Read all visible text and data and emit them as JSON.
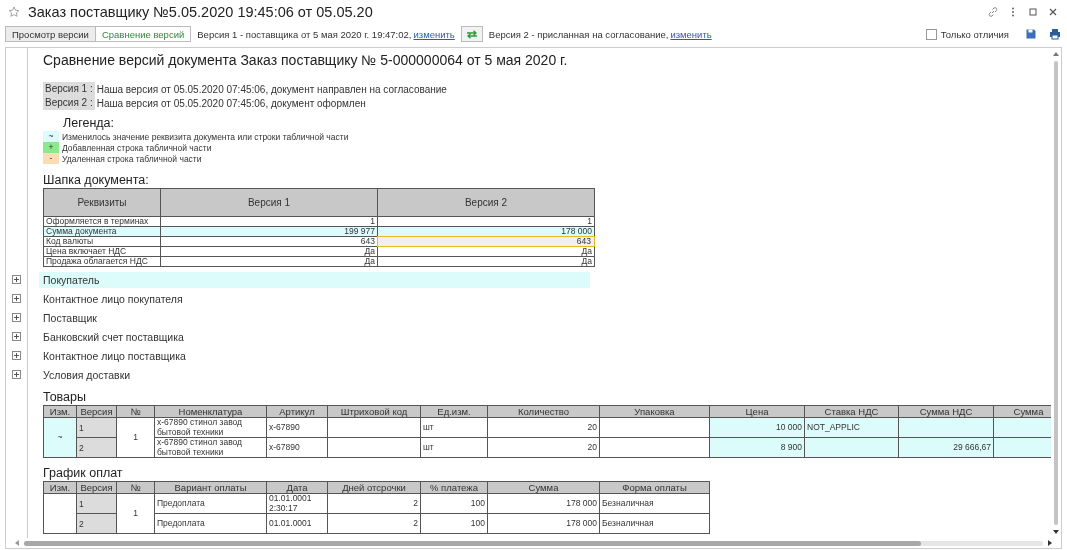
{
  "window": {
    "title": "Заказ поставщику №5.05.2020 19:45:06 от 05.05.20"
  },
  "toolbar": {
    "view_tabs": [
      {
        "label": "Просмотр версии",
        "selected": false
      },
      {
        "label": "Сравнение версий",
        "selected": true
      }
    ],
    "version1": {
      "text": "Версия 1 - поставщика от 5 мая 2020 г. 19:47:02,",
      "link": "изменить"
    },
    "version2": {
      "text": "Версия 2 - присланная на согласование,",
      "link": "изменить"
    },
    "only_differences": {
      "label": "Только отличия",
      "checked": false
    }
  },
  "document": {
    "title": "Сравнение версий документа Заказ поставщику № 5-000000064 от 5 мая 2020 г.",
    "versions": [
      {
        "label": "Версия 1 :",
        "text": "Наша версия от 05.05.2020 07:45:06, документ направлен на согласование"
      },
      {
        "label": "Версия 2 :",
        "text": "Наша версия от 05.05.2020 07:45:06, документ оформлен"
      }
    ],
    "legend": {
      "title": "Легенда:",
      "items": [
        {
          "mark": "~",
          "text": "Изменилось значение реквизита документа или строки табличной части",
          "color": "#dcfcfc"
        },
        {
          "mark": "+",
          "text": "Добавленная строка табличной части",
          "color": "#8ce88c"
        },
        {
          "mark": "-",
          "text": "Удаленная строка табличной части",
          "color": "#fcdcb4"
        }
      ]
    },
    "header_section": {
      "title": "Шапка документа:",
      "columns": [
        "Реквизиты",
        "Версия 1",
        "Версия 2"
      ],
      "rows": [
        {
          "cells": [
            "Оформляется в терминах",
            "1",
            "1"
          ],
          "changed": false,
          "selected": false
        },
        {
          "cells": [
            "Сумма документа",
            "199 977",
            "178 000"
          ],
          "changed": true,
          "selected": false
        },
        {
          "cells": [
            "Код валюты",
            "643",
            "643"
          ],
          "changed": false,
          "selected": true
        },
        {
          "cells": [
            "Цена включает НДС",
            "Да",
            "Да"
          ],
          "changed": false,
          "selected": false
        },
        {
          "cells": [
            "Продажа облагается НДС",
            "Да",
            "Да"
          ],
          "changed": false,
          "selected": false
        }
      ]
    },
    "groups": [
      {
        "label": "Покупатель",
        "changed": true,
        "expanded": false
      },
      {
        "label": "Контактное лицо покупателя",
        "changed": false,
        "expanded": false
      },
      {
        "label": "Поставщик",
        "changed": false,
        "expanded": false
      },
      {
        "label": "Банковский счет поставщика",
        "changed": false,
        "expanded": false
      },
      {
        "label": "Контактное лицо поставщика",
        "changed": false,
        "expanded": false
      },
      {
        "label": "Условия доставки",
        "changed": false,
        "expanded": false
      }
    ],
    "tables": [
      {
        "title": "Товары",
        "columns": [
          {
            "label": "Изм.",
            "kind": "center"
          },
          {
            "label": "Версия",
            "kind": "text"
          },
          {
            "label": "№",
            "kind": "center"
          },
          {
            "label": "Номенклатура",
            "kind": "text"
          },
          {
            "label": "Артикул",
            "kind": "text"
          },
          {
            "label": "Штриховой код",
            "kind": "text"
          },
          {
            "label": "Ед.изм.",
            "kind": "text"
          },
          {
            "label": "Количество",
            "kind": "number"
          },
          {
            "label": "Упаковка",
            "kind": "text"
          },
          {
            "label": "Цена",
            "kind": "number"
          },
          {
            "label": "Ставка НДС",
            "kind": "text"
          },
          {
            "label": "Сумма НДС",
            "kind": "number"
          },
          {
            "label": "Сумма",
            "kind": "number"
          }
        ],
        "items": [
          {
            "change": "~",
            "changed": true,
            "number": "1",
            "versions": [
              {
                "version": "1",
                "cells": [
                  {
                    "text": "x-67890 стинол завод бытовой техники",
                    "changed": false
                  },
                  {
                    "text": "x-67890",
                    "changed": false
                  },
                  {
                    "changed": false
                  },
                  {
                    "text": "шт",
                    "changed": false
                  },
                  {
                    "text": "20",
                    "changed": false
                  },
                  {
                    "changed": false
                  },
                  {
                    "text": "10 000",
                    "changed": true
                  },
                  {
                    "text": "NOT_APPLIC",
                    "changed": true
                  },
                  {
                    "changed": true
                  },
                  {
                    "changed": true
                  }
                ]
              },
              {
                "version": "2",
                "cells": [
                  {
                    "text": "x-67890 стинол завод бытовой техники",
                    "changed": false
                  },
                  {
                    "text": "x-67890",
                    "changed": false
                  },
                  {
                    "changed": false
                  },
                  {
                    "text": "шт",
                    "changed": false
                  },
                  {
                    "text": "20",
                    "changed": false
                  },
                  {
                    "changed": false
                  },
                  {
                    "text": "8 900",
                    "changed": true
                  },
                  {
                    "changed": true
                  },
                  {
                    "text": "29 666,67",
                    "changed": true
                  },
                  {
                    "changed": true
                  }
                ]
              }
            ]
          }
        ]
      },
      {
        "title": "График оплат",
        "columns": [
          {
            "label": "Изм.",
            "kind": "center"
          },
          {
            "label": "Версия",
            "kind": "text"
          },
          {
            "label": "№",
            "kind": "center"
          },
          {
            "label": "Вариант оплаты",
            "kind": "text"
          },
          {
            "label": "Дата",
            "kind": "text"
          },
          {
            "label": "Дней отсрочки",
            "kind": "number"
          },
          {
            "label": "% платежа",
            "kind": "number"
          },
          {
            "label": "Сумма",
            "kind": "number"
          },
          {
            "label": "Форма оплаты",
            "kind": "text"
          }
        ],
        "items": [
          {
            "changed": false,
            "number": "1",
            "versions": [
              {
                "version": "1",
                "cells": [
                  {
                    "text": "Предоплата",
                    "changed": false
                  },
                  {
                    "text": "01.01.0001 2:30:17",
                    "changed": false
                  },
                  {
                    "text": "2",
                    "changed": false
                  },
                  {
                    "text": "100",
                    "changed": false
                  },
                  {
                    "text": "178 000",
                    "changed": false
                  },
                  {
                    "text": "Безналичная",
                    "changed": false
                  }
                ]
              },
              {
                "version": "2",
                "cells": [
                  {
                    "text": "Предоплата",
                    "changed": false
                  },
                  {
                    "text": "01.01.0001",
                    "changed": false
                  },
                  {
                    "text": "2",
                    "changed": false
                  },
                  {
                    "text": "100",
                    "changed": false
                  },
                  {
                    "text": "178 000",
                    "changed": false
                  },
                  {
                    "text": "Безналичная",
                    "changed": false
                  }
                ]
              }
            ]
          }
        ]
      }
    ]
  }
}
